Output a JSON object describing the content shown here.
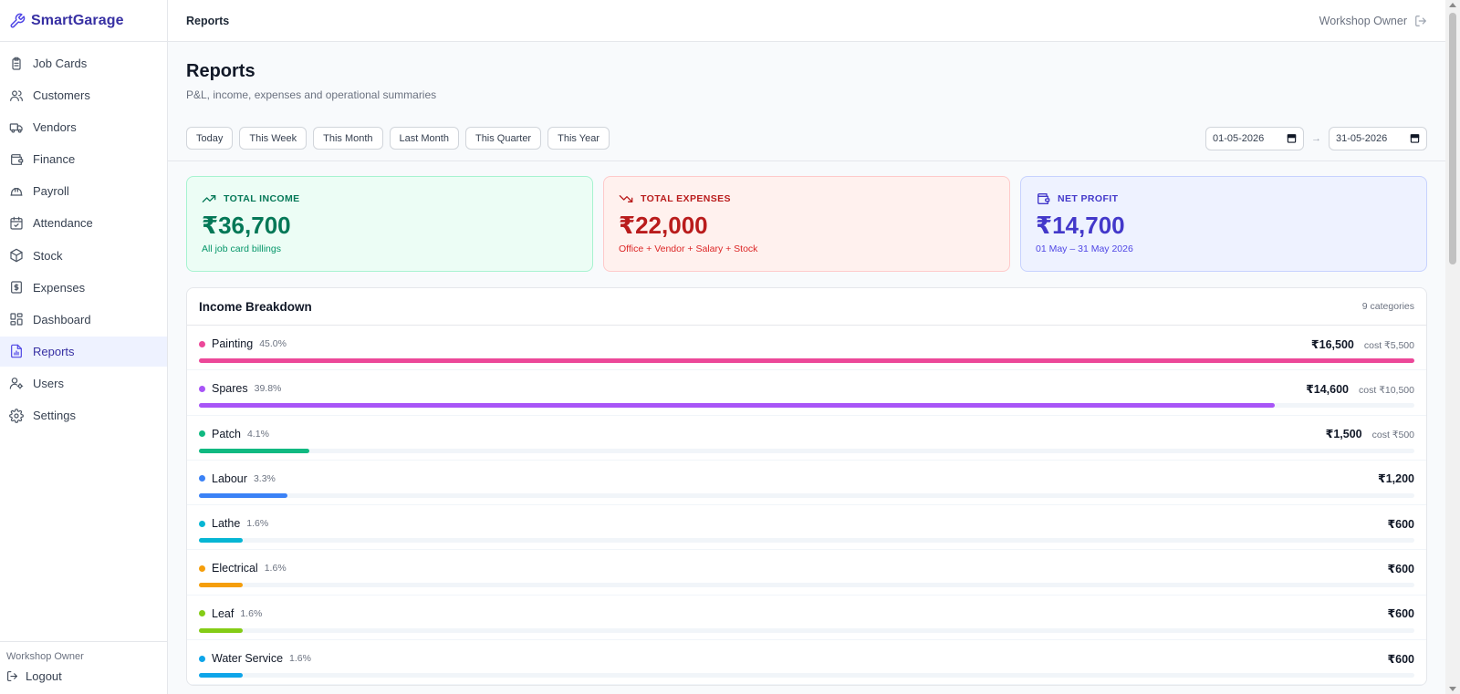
{
  "app": {
    "name": "SmartGarage"
  },
  "sidebar": {
    "items": [
      {
        "label": "Job Cards",
        "icon": "clipboard-icon",
        "active": false
      },
      {
        "label": "Customers",
        "icon": "users-icon",
        "active": false
      },
      {
        "label": "Vendors",
        "icon": "truck-icon",
        "active": false
      },
      {
        "label": "Finance",
        "icon": "wallet-icon",
        "active": false
      },
      {
        "label": "Payroll",
        "icon": "hardhat-icon",
        "active": false
      },
      {
        "label": "Attendance",
        "icon": "calendar-check-icon",
        "active": false
      },
      {
        "label": "Stock",
        "icon": "package-icon",
        "active": false
      },
      {
        "label": "Expenses",
        "icon": "receipt-icon",
        "active": false
      },
      {
        "label": "Dashboard",
        "icon": "dashboard-icon",
        "active": false
      },
      {
        "label": "Reports",
        "icon": "file-chart-icon",
        "active": true
      },
      {
        "label": "Users",
        "icon": "user-cog-icon",
        "active": false
      },
      {
        "label": "Settings",
        "icon": "gear-icon",
        "active": false
      }
    ],
    "footer_user": "Workshop Owner",
    "logout_label": "Logout"
  },
  "topbar": {
    "title": "Reports",
    "user": "Workshop Owner"
  },
  "page": {
    "title": "Reports",
    "subtitle": "P&L, income, expenses and operational summaries"
  },
  "filters": {
    "presets": [
      "Today",
      "This Week",
      "This Month",
      "Last Month",
      "This Quarter",
      "This Year"
    ],
    "from_date": "01-05-2026",
    "arrow": "→",
    "to_date": "31-05-2026"
  },
  "cards": {
    "income": {
      "label": "TOTAL INCOME",
      "value": "₹36,700",
      "note": "All job card billings"
    },
    "expense": {
      "label": "TOTAL EXPENSES",
      "value": "₹22,000",
      "note": "Office + Vendor + Salary + Stock"
    },
    "profit": {
      "label": "NET PROFIT",
      "value": "₹14,700",
      "note": "01 May – 31 May 2026"
    }
  },
  "breakdown": {
    "title": "Income Breakdown",
    "count": "9 categories",
    "rows": [
      {
        "name": "Painting",
        "pct": "45.0%",
        "amount": "₹16,500",
        "cost": "cost ₹5,500",
        "fill": 1.0,
        "color": "#ec4899"
      },
      {
        "name": "Spares",
        "pct": "39.8%",
        "amount": "₹14,600",
        "cost": "cost ₹10,500",
        "fill": 0.885,
        "color": "#a855f7"
      },
      {
        "name": "Patch",
        "pct": "4.1%",
        "amount": "₹1,500",
        "cost": "cost ₹500",
        "fill": 0.091,
        "color": "#10b981"
      },
      {
        "name": "Labour",
        "pct": "3.3%",
        "amount": "₹1,200",
        "cost": "",
        "fill": 0.073,
        "color": "#3b82f6"
      },
      {
        "name": "Lathe",
        "pct": "1.6%",
        "amount": "₹600",
        "cost": "",
        "fill": 0.036,
        "color": "#06b6d4"
      },
      {
        "name": "Electrical",
        "pct": "1.6%",
        "amount": "₹600",
        "cost": "",
        "fill": 0.036,
        "color": "#f59e0b"
      },
      {
        "name": "Leaf",
        "pct": "1.6%",
        "amount": "₹600",
        "cost": "",
        "fill": 0.036,
        "color": "#84cc16"
      },
      {
        "name": "Water Service",
        "pct": "1.6%",
        "amount": "₹600",
        "cost": "",
        "fill": 0.036,
        "color": "#0ea5e9"
      }
    ]
  }
}
